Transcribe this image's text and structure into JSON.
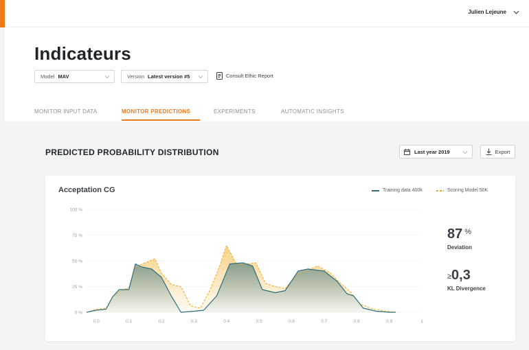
{
  "user": {
    "name": "Julien Lejeune"
  },
  "page": {
    "title": "Indicateurs"
  },
  "filters": {
    "model": {
      "label": "Model",
      "value": "MAV"
    },
    "version": {
      "label": "Version",
      "value": "Latest version #5"
    },
    "ethic_link": "Consult Ethic Report"
  },
  "tabs": [
    {
      "label": "MONITOR INPUT DATA"
    },
    {
      "label": "MONITOR PREDICTIONS",
      "active": true
    },
    {
      "label": "EXPERIMENTS"
    },
    {
      "label": "AUTOMATIC INSIGHTS"
    }
  ],
  "section": {
    "title": "PREDICTED PROBABILITY DISTRIBUTION",
    "date_range": "Last year 2019",
    "export_label": "Export"
  },
  "card": {
    "title": "Acceptation CG",
    "stats": {
      "deviation": {
        "value": "87",
        "unit": "%",
        "label": "Deviation"
      },
      "kl": {
        "prefix": "≥",
        "value": "0,3",
        "label": "KL Divergence"
      }
    }
  },
  "colors": {
    "accent": "#f07a1a",
    "training": "#2d6e7e",
    "scoring": "#f5a623"
  },
  "chart_data": {
    "type": "area",
    "xlim": [
      -0.03,
      1.0
    ],
    "ylim": [
      0,
      100
    ],
    "x_ticks": [
      "0.0",
      "0.1",
      "0.2",
      "0.3",
      "0.4",
      "0.5",
      "0.6",
      "0.7",
      "0.8",
      "0.9",
      "1"
    ],
    "x_tick_values": [
      0,
      0.1,
      0.2,
      0.3,
      0.4,
      0.5,
      0.6,
      0.7,
      0.8,
      0.9,
      1.0
    ],
    "y_ticks": [
      "0 %",
      "25 %",
      "50 %",
      "75 %",
      "100 %"
    ],
    "y_tick_values": [
      0,
      25,
      50,
      75,
      100
    ],
    "grid": true,
    "legend_position": "top-right",
    "series": [
      {
        "name": "Training data 400k",
        "style": "solid",
        "points": [
          [
            -0.03,
            0
          ],
          [
            0.0,
            2
          ],
          [
            0.03,
            3
          ],
          [
            0.05,
            15
          ],
          [
            0.07,
            22
          ],
          [
            0.1,
            22
          ],
          [
            0.12,
            47
          ],
          [
            0.14,
            44
          ],
          [
            0.17,
            42
          ],
          [
            0.2,
            34
          ],
          [
            0.23,
            16
          ],
          [
            0.26,
            0
          ],
          [
            0.3,
            1
          ],
          [
            0.33,
            2
          ],
          [
            0.37,
            16
          ],
          [
            0.41,
            47
          ],
          [
            0.45,
            48
          ],
          [
            0.48,
            45
          ],
          [
            0.51,
            22
          ],
          [
            0.55,
            19
          ],
          [
            0.58,
            21
          ],
          [
            0.62,
            40
          ],
          [
            0.65,
            42
          ],
          [
            0.7,
            40
          ],
          [
            0.74,
            30
          ],
          [
            0.77,
            18
          ],
          [
            0.79,
            16
          ],
          [
            0.82,
            4
          ],
          [
            0.86,
            1
          ],
          [
            0.9,
            0
          ],
          [
            0.92,
            0
          ]
        ]
      },
      {
        "name": "Scoring Model 50K",
        "style": "dashed",
        "points": [
          [
            -0.03,
            0
          ],
          [
            0.0,
            3
          ],
          [
            0.03,
            4
          ],
          [
            0.05,
            15
          ],
          [
            0.07,
            20
          ],
          [
            0.1,
            24
          ],
          [
            0.12,
            44
          ],
          [
            0.15,
            48
          ],
          [
            0.18,
            52
          ],
          [
            0.2,
            38
          ],
          [
            0.23,
            27
          ],
          [
            0.26,
            25
          ],
          [
            0.29,
            6
          ],
          [
            0.32,
            4
          ],
          [
            0.35,
            22
          ],
          [
            0.38,
            46
          ],
          [
            0.4,
            65
          ],
          [
            0.43,
            47
          ],
          [
            0.46,
            47
          ],
          [
            0.49,
            48
          ],
          [
            0.52,
            28
          ],
          [
            0.55,
            25
          ],
          [
            0.58,
            23
          ],
          [
            0.62,
            38
          ],
          [
            0.65,
            41
          ],
          [
            0.68,
            45
          ],
          [
            0.72,
            38
          ],
          [
            0.75,
            28
          ],
          [
            0.78,
            20
          ],
          [
            0.81,
            8
          ],
          [
            0.85,
            3
          ],
          [
            0.89,
            1
          ],
          [
            0.92,
            0
          ]
        ]
      }
    ]
  }
}
